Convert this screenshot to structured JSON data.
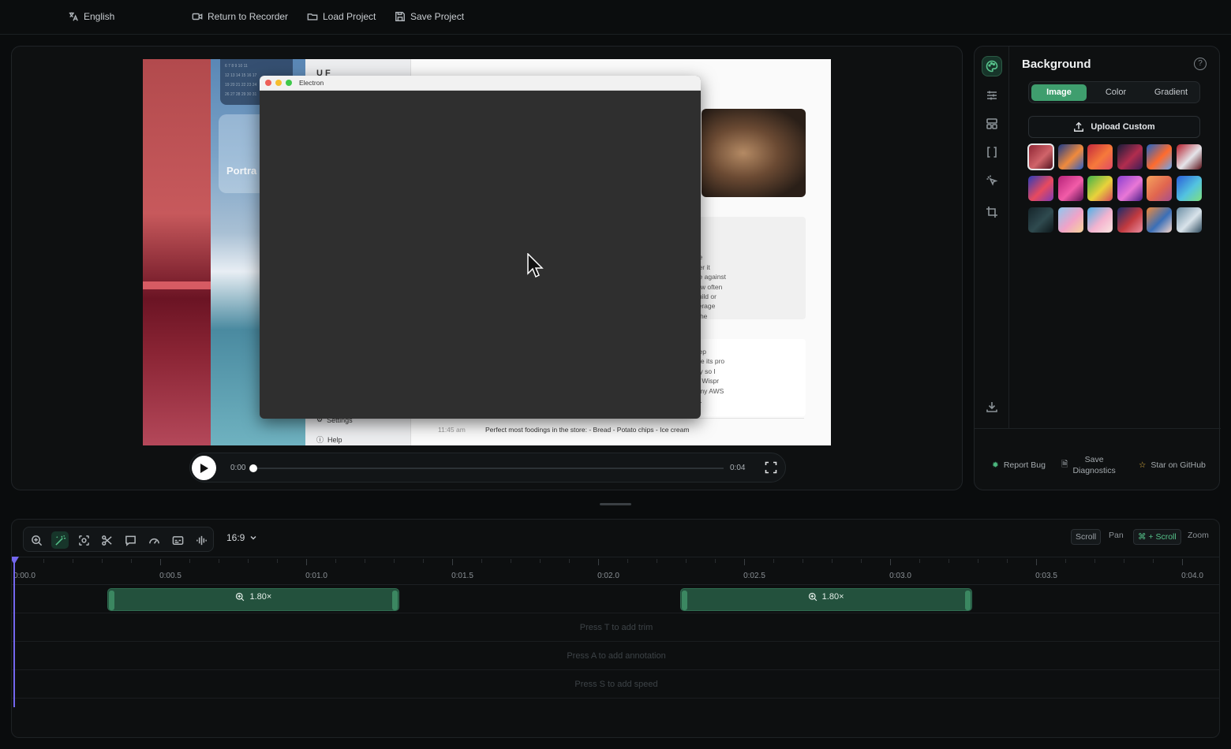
{
  "topbar": {
    "language": "English",
    "return": "Return to Recorder",
    "load": "Load Project",
    "save": "Save Project"
  },
  "canvas": {
    "window_title": "Electron",
    "app_sidebar": {
      "settings": "Settings",
      "help": "Help"
    },
    "portrait_label": "Portra",
    "card_text_1": [
      "rage",
      "m the",
      "hether it",
      "rence against",
      "of how often",
      "n't build or",
      "t leverage",
      "site the"
    ],
    "card_text_2": [
      "o deep",
      "create its pro",
      "ocally so I",
      "what Wispr",
      "use my AWS",
      "rofile."
    ],
    "note_time": "11:45 am",
    "note_text": "Perfect most foodings in the store: - Bread - Potato chips - Ice cream",
    "header_fragment": "U F"
  },
  "player": {
    "current": "0:00",
    "duration": "0:04",
    "progress": 0
  },
  "side_panel": {
    "title": "Background",
    "tabs": [
      "Image",
      "Color",
      "Gradient"
    ],
    "active_tab": "Image",
    "upload": "Upload Custom",
    "footer": {
      "report": "Report Bug",
      "diagnostics_line1": "Save",
      "diagnostics_line2": "Diagnostics",
      "star": "Star on GitHub"
    },
    "wallpapers": [
      {
        "name": "wallpaper-crimson-dunes",
        "c1": "#8c2231",
        "c2": "#d0646a",
        "c3": "#4a0d1a"
      },
      {
        "name": "wallpaper-blue-orange-waves",
        "c1": "#1b3a8a",
        "c2": "#f08a3c",
        "c3": "#2d5ec4"
      },
      {
        "name": "wallpaper-red-orange-waves",
        "c1": "#c4283c",
        "c2": "#f6793b",
        "c3": "#e04a67"
      },
      {
        "name": "wallpaper-dark-purple-ridge",
        "c1": "#171b3a",
        "c2": "#b12d4e",
        "c3": "#3b1c57"
      },
      {
        "name": "wallpaper-orange-blue-curve",
        "c1": "#1e64c8",
        "c2": "#ff6b2d",
        "c3": "#69a6f0"
      },
      {
        "name": "wallpaper-red-silver-fold",
        "c1": "#b51d2c",
        "c2": "#e5e5ea",
        "c3": "#5a0f17"
      },
      {
        "name": "wallpaper-violet-sunset",
        "c1": "#2b3cb8",
        "c2": "#e84a5f",
        "c3": "#7c3ab5"
      },
      {
        "name": "wallpaper-magenta-swirl",
        "c1": "#b7237a",
        "c2": "#f25ca8",
        "c3": "#5b1255"
      },
      {
        "name": "wallpaper-rainbow-hills",
        "c1": "#3fb24a",
        "c2": "#e9d23b",
        "c3": "#d5475d"
      },
      {
        "name": "wallpaper-purple-peaks",
        "c1": "#8a3fd1",
        "c2": "#e977d6",
        "c3": "#4a1e8a"
      },
      {
        "name": "wallpaper-peach-gradient",
        "c1": "#f5a25d",
        "c2": "#e1664f",
        "c3": "#a74f8f"
      },
      {
        "name": "wallpaper-blue-green-gradient",
        "c1": "#2a5dd8",
        "c2": "#53c3e0",
        "c3": "#7ee07e"
      },
      {
        "name": "wallpaper-dark-mountain",
        "c1": "#15252b",
        "c2": "#2f4a4f",
        "c3": "#0d1619"
      },
      {
        "name": "wallpaper-pastel-rainbow",
        "c1": "#8ec6ef",
        "c2": "#f1a3c7",
        "c3": "#f6d59a"
      },
      {
        "name": "wallpaper-pastel-blue-pink",
        "c1": "#4db0e6",
        "c2": "#f4b3cf",
        "c3": "#f9e5e0"
      },
      {
        "name": "wallpaper-red-blue-arc",
        "c1": "#1a2c6b",
        "c2": "#c23a3f",
        "c3": "#e98da0"
      },
      {
        "name": "wallpaper-colorful-stripes",
        "c1": "#ef8a3b",
        "c2": "#3a6fb8",
        "c3": "#f6d6c9"
      },
      {
        "name": "wallpaper-coastal-photo",
        "c1": "#6b8ea5",
        "c2": "#d9e3ea",
        "c3": "#2e4b5e"
      }
    ],
    "selected_wallpaper": 0
  },
  "timeline": {
    "aspect": "16:9",
    "hints": {
      "scroll": "Scroll",
      "pan": "Pan",
      "ctrl_scroll": "⌘ + Scroll",
      "zoom": "Zoom"
    },
    "ticks": [
      "0:00.0",
      "0:00.5",
      "0:01.0",
      "0:01.5",
      "0:02.0",
      "0:02.5",
      "0:03.0",
      "0:03.5",
      "0:04.0"
    ],
    "max_seconds": 4.1,
    "zoom_clips": [
      {
        "label": "1.80×",
        "start": 0.32,
        "end": 1.32
      },
      {
        "label": "1.80×",
        "start": 2.28,
        "end": 3.28
      }
    ],
    "placeholders": [
      "Press T to add trim",
      "Press A to add annotation",
      "Press S to add speed"
    ]
  },
  "colors": {
    "accent": "#3f9e6e",
    "playhead": "#7367ee",
    "zoom_clip": "#23513d"
  }
}
